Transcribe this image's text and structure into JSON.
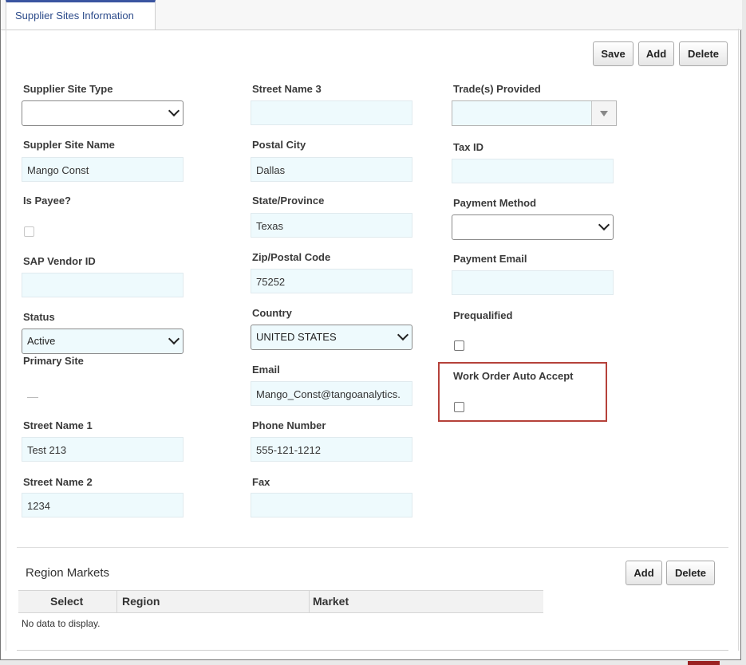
{
  "tab": {
    "label": "Supplier Sites Information"
  },
  "toolbar": {
    "save_label": "Save",
    "add_label": "Add",
    "delete_label": "Delete"
  },
  "form": {
    "supplier_site_type": {
      "label": "Supplier Site Type",
      "value": ""
    },
    "supplier_site_name": {
      "label": "Suppler Site Name",
      "value": "Mango Const"
    },
    "is_payee": {
      "label": "Is Payee?",
      "checked": false
    },
    "sap_vendor_id": {
      "label": "SAP Vendor ID",
      "value": ""
    },
    "status": {
      "label": "Status",
      "value": "Active"
    },
    "primary_site": {
      "label": "Primary Site"
    },
    "street_name_1": {
      "label": "Street Name 1",
      "value": "Test 213"
    },
    "street_name_2": {
      "label": "Street Name 2",
      "value": "1234"
    },
    "street_name_3": {
      "label": "Street Name 3",
      "value": ""
    },
    "postal_city": {
      "label": "Postal City",
      "value": "Dallas"
    },
    "state_province": {
      "label": "State/Province",
      "value": "Texas"
    },
    "zip_postal_code": {
      "label": "Zip/Postal Code",
      "value": "75252"
    },
    "country": {
      "label": "Country",
      "value": "UNITED STATES"
    },
    "email": {
      "label": "Email",
      "value": "Mango_Const@tangoanalytics."
    },
    "phone_number": {
      "label": "Phone Number",
      "value": "555-121-1212"
    },
    "fax": {
      "label": "Fax",
      "value": ""
    },
    "trades_provided": {
      "label": "Trade(s) Provided",
      "value": ""
    },
    "tax_id": {
      "label": "Tax ID",
      "value": ""
    },
    "payment_method": {
      "label": "Payment Method",
      "value": ""
    },
    "payment_email": {
      "label": "Payment Email",
      "value": ""
    },
    "prequalified": {
      "label": "Prequalified",
      "checked": false
    },
    "work_order_auto_accept": {
      "label": "Work Order Auto Accept",
      "checked": false
    }
  },
  "region_markets": {
    "title": "Region Markets",
    "add_label": "Add",
    "delete_label": "Delete",
    "columns": [
      "Select",
      "Region",
      "Market"
    ],
    "empty_text": "No data to display."
  },
  "colors": {
    "highlight": "#b5413a",
    "tab_accent": "#3a55a0",
    "field_bg": "#eefafd"
  }
}
